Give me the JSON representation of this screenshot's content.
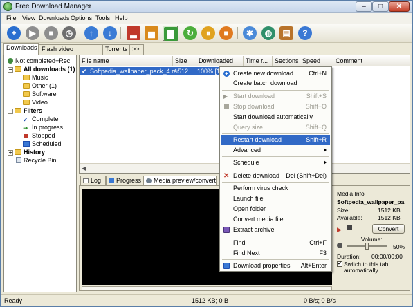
{
  "window": {
    "title": "Free Download Manager"
  },
  "menubar": [
    "File",
    "View",
    "Downloads",
    "Options",
    "Tools",
    "Help"
  ],
  "category_tabs": [
    "Downloads",
    "Flash video downloads",
    "Torrents",
    ">>"
  ],
  "tree": {
    "not_completed": "Not completed+Rec",
    "all_downloads": "All downloads (1)",
    "music": "Music",
    "other": "Other (1)",
    "software": "Software",
    "video": "Video",
    "filters": "Filters",
    "complete": "Complete",
    "in_progress": "In progress",
    "stopped": "Stopped",
    "scheduled": "Scheduled",
    "history": "History",
    "recycle_bin": "Recycle Bin"
  },
  "list": {
    "columns": [
      "File name",
      "Size",
      "Downloaded",
      "Time r...",
      "Sections",
      "Speed",
      "Comment"
    ],
    "rows": [
      {
        "file_name": "Softpedia_wallpaper_pack_4.rar",
        "size": "1512 ...",
        "downloaded": "100% [15"
      }
    ]
  },
  "bottom_tabs": [
    "Log",
    "Progress",
    "Media preview/convert"
  ],
  "media_info": {
    "heading": "Media Info",
    "file": "Softpedia_wallpaper_pa",
    "size_label": "Size:",
    "size_value": "1512 KB",
    "available_label": "Available:",
    "available_value": "1512 KB",
    "convert_label": "Convert",
    "volume_label": "Volume:",
    "volume_value": "50%",
    "volume_level": 0.5,
    "duration_label": "Duration:",
    "duration_value": "00:00/00:00",
    "switch_label_1": "Switch to this tab",
    "switch_label_2": "automatically"
  },
  "statusbar": {
    "status": "Ready",
    "size": "1512 KB; 0 B",
    "speed": "0 B/s; 0 B/s"
  },
  "context_menu": {
    "items": [
      {
        "label": "Create new download",
        "shortcut": "Ctrl+N",
        "state": "normal",
        "icon": "plus-icon"
      },
      {
        "label": "Create batch download",
        "shortcut": "",
        "state": "normal"
      },
      {
        "label": "Start download",
        "shortcut": "Shift+S",
        "state": "disabled",
        "icon": "play-icon"
      },
      {
        "label": "Stop download",
        "shortcut": "Shift+O",
        "state": "disabled",
        "icon": "stop-icon"
      },
      {
        "label": "Start download automatically",
        "shortcut": "",
        "state": "normal"
      },
      {
        "label": "Query size",
        "shortcut": "Shift+Q",
        "state": "disabled"
      },
      {
        "label": "Restart download",
        "shortcut": "Shift+R",
        "state": "highlighted"
      },
      {
        "label": "Advanced",
        "shortcut": "",
        "state": "submenu"
      },
      {
        "label": "Schedule",
        "shortcut": "",
        "state": "submenu"
      },
      {
        "label": "Delete download",
        "shortcut": "Del (Shift+Del)",
        "state": "normal",
        "icon": "delete-icon"
      },
      {
        "label": "Perform virus check",
        "shortcut": "",
        "state": "normal"
      },
      {
        "label": "Launch file",
        "shortcut": "",
        "state": "normal"
      },
      {
        "label": "Open folder",
        "shortcut": "",
        "state": "normal"
      },
      {
        "label": "Convert media file",
        "shortcut": "",
        "state": "normal"
      },
      {
        "label": "Extract archive",
        "shortcut": "",
        "state": "normal",
        "icon": "archive-icon"
      },
      {
        "label": "Find",
        "shortcut": "Ctrl+F",
        "state": "normal"
      },
      {
        "label": "Find Next",
        "shortcut": "F3",
        "state": "normal"
      },
      {
        "label": "Download properties",
        "shortcut": "Alt+Enter",
        "state": "normal",
        "icon": "properties-icon"
      }
    ]
  },
  "colors": {
    "highlight": "#3169c6",
    "window_bg": "#ece9d8",
    "media_bg": "#000000"
  }
}
